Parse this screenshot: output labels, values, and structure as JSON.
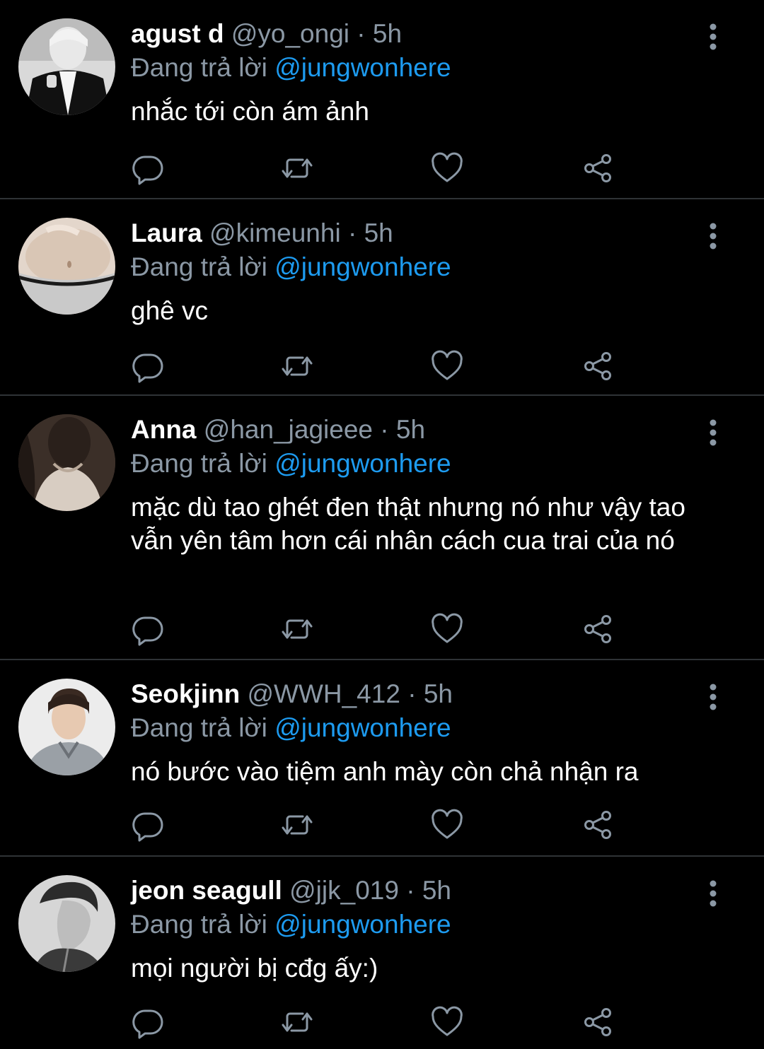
{
  "colors": {
    "background": "#000000",
    "primary_text": "#ffffff",
    "secondary_text": "#8b98a5",
    "mention": "#1d9bf0",
    "divider": "#2f3336"
  },
  "reply_prefix": "Đang trả lời",
  "icons": {
    "reply": "reply-icon",
    "retweet": "retweet-icon",
    "like": "heart-icon",
    "share": "share-icon",
    "more": "more-vertical-icon"
  },
  "tweets": [
    {
      "display_name": "agust d",
      "handle": "@yo_ongi",
      "separator": "·",
      "time": "5h",
      "reply_to": "@jungwonhere",
      "text": "nhắc tới còn ám ảnh"
    },
    {
      "display_name": "Laura",
      "handle": "@kimeunhi",
      "separator": "·",
      "time": "5h",
      "reply_to": "@jungwonhere",
      "text": "ghê vc"
    },
    {
      "display_name": "Anna",
      "handle": "@han_jagieee",
      "separator": "·",
      "time": "5h",
      "reply_to": "@jungwonhere",
      "text": "mặc dù tao ghét đen thật nhưng nó như vậy tao vẫn yên tâm hơn cái nhân cách cua trai của nó"
    },
    {
      "display_name": "Seokjinn",
      "handle": "@WWH_412",
      "separator": "·",
      "time": "5h",
      "reply_to": "@jungwonhere",
      "text": "nó bước vào tiệm anh mày còn chả nhận ra"
    },
    {
      "display_name": "jeon seagull",
      "handle": "@jjk_019",
      "separator": "·",
      "time": "5h",
      "reply_to": "@jungwonhere",
      "text": "mọi người bị cđg ấy:)"
    }
  ]
}
